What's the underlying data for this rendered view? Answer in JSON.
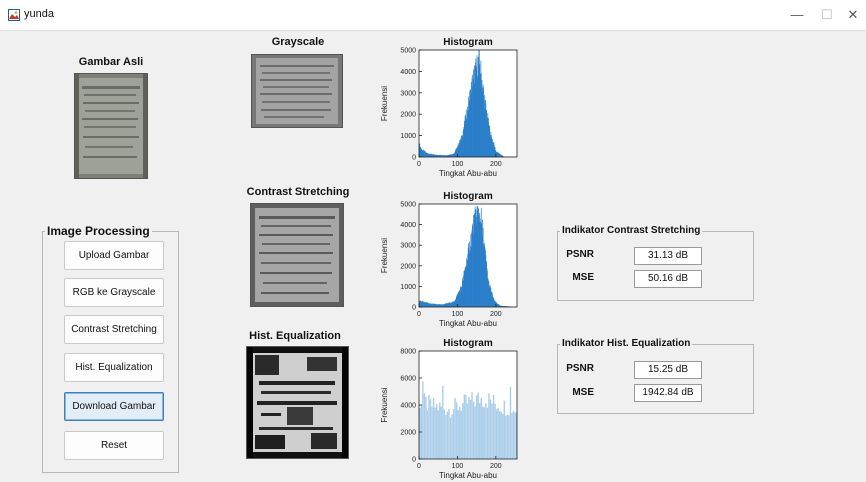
{
  "window": {
    "title": "yunda",
    "minimize": "—",
    "maximize": "☐",
    "close": "✕"
  },
  "panels": {
    "original_title": "Gambar Asli",
    "grayscale_title": "Grayscale",
    "contrast_title": "Contrast Stretching",
    "equalization_title": "Hist. Equalization"
  },
  "histograms": {
    "title": "Histogram",
    "xlabel": "Tingkat Abu-abu",
    "ylabel": "Frekuensi",
    "bar_color": "#2b7fc9",
    "equalized_bar_color": "#a9cdea"
  },
  "chart_data": [
    {
      "type": "bar",
      "title": "Histogram",
      "xlabel": "Tingkat Abu-abu",
      "ylabel": "Frekuensi",
      "xlim": [
        0,
        255
      ],
      "ylim": [
        0,
        5000
      ],
      "xticks": [
        0,
        100,
        200
      ],
      "yticks": [
        0,
        1000,
        2000,
        3000,
        4000,
        5000
      ],
      "peaks": [
        [
          0,
          600
        ],
        [
          6,
          350
        ],
        [
          20,
          180
        ],
        [
          40,
          100
        ],
        [
          70,
          80
        ],
        [
          90,
          150
        ],
        [
          110,
          900
        ],
        [
          125,
          2200
        ],
        [
          140,
          3700
        ],
        [
          155,
          4500
        ],
        [
          160,
          4000
        ],
        [
          170,
          2600
        ],
        [
          185,
          1100
        ],
        [
          200,
          250
        ],
        [
          220,
          20
        ],
        [
          255,
          0
        ]
      ]
    },
    {
      "type": "bar",
      "title": "Histogram",
      "xlabel": "Tingkat Abu-abu",
      "ylabel": "Frekuensi",
      "xlim": [
        0,
        255
      ],
      "ylim": [
        0,
        5000
      ],
      "xticks": [
        0,
        100,
        200
      ],
      "yticks": [
        0,
        1000,
        2000,
        3000,
        4000,
        5000
      ],
      "peaks": [
        [
          0,
          300
        ],
        [
          10,
          250
        ],
        [
          30,
          150
        ],
        [
          60,
          120
        ],
        [
          90,
          250
        ],
        [
          110,
          1000
        ],
        [
          125,
          2400
        ],
        [
          140,
          3900
        ],
        [
          150,
          4600
        ],
        [
          160,
          4400
        ],
        [
          170,
          2800
        ],
        [
          180,
          1200
        ],
        [
          195,
          300
        ],
        [
          210,
          60
        ],
        [
          255,
          0
        ]
      ]
    },
    {
      "type": "bar",
      "title": "Histogram",
      "xlabel": "Tingkat Abu-abu",
      "ylabel": "Frekuensi",
      "xlim": [
        0,
        255
      ],
      "ylim": [
        0,
        8000
      ],
      "xticks": [
        0,
        100,
        200
      ],
      "yticks": [
        0,
        2000,
        4000,
        6000,
        8000
      ],
      "peaks": [
        [
          0,
          4300
        ],
        [
          20,
          4100
        ],
        [
          40,
          3900
        ],
        [
          60,
          3800
        ],
        [
          80,
          3700
        ],
        [
          100,
          3900
        ],
        [
          120,
          4100
        ],
        [
          140,
          4300
        ],
        [
          160,
          4500
        ],
        [
          180,
          4400
        ],
        [
          200,
          4100
        ],
        [
          220,
          3900
        ],
        [
          240,
          3800
        ],
        [
          255,
          3600
        ]
      ]
    }
  ],
  "processing": {
    "title": "Image Processing",
    "buttons": [
      {
        "label": "Upload Gambar"
      },
      {
        "label": "RGB ke Grayscale"
      },
      {
        "label": "Contrast Stretching"
      },
      {
        "label": "Hist. Equalization"
      },
      {
        "label": "Download Gambar"
      },
      {
        "label": "Reset"
      }
    ]
  },
  "indicators": {
    "contrast": {
      "title": "Indikator Contrast Stretching",
      "psnr_label": "PSNR",
      "psnr_value": "31.13 dB",
      "mse_label": "MSE",
      "mse_value": "50.16 dB"
    },
    "equalization": {
      "title": "Indikator Hist. Equalization",
      "psnr_label": "PSNR",
      "psnr_value": "15.25 dB",
      "mse_label": "MSE",
      "mse_value": "1942.84 dB"
    }
  }
}
